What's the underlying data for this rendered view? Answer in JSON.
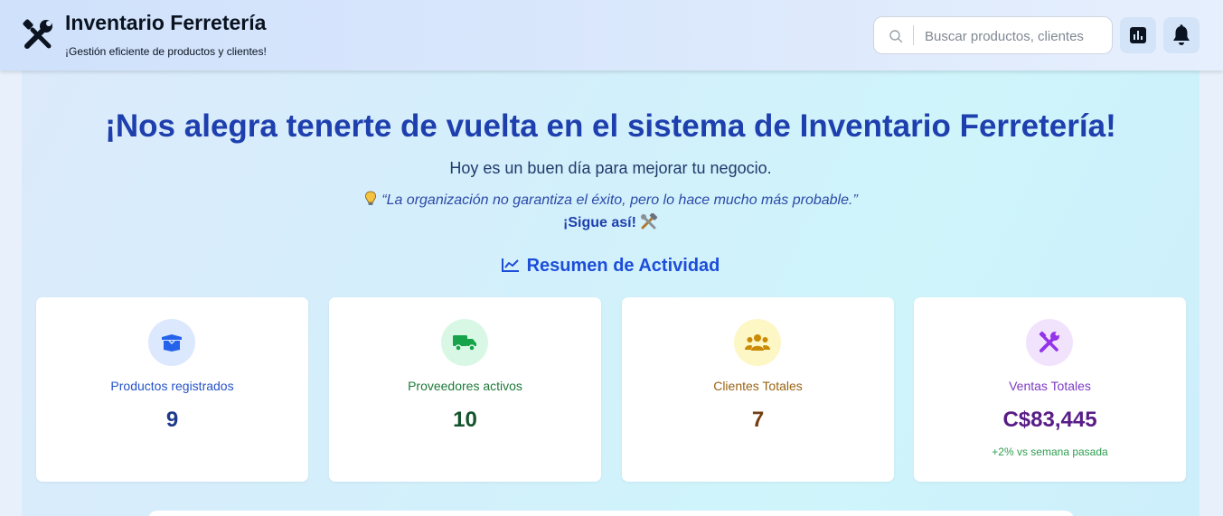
{
  "header": {
    "title": "Inventario Ferretería",
    "subtitle": "¡Gestión eficiente de productos y clientes!",
    "logo_icon": "tools-icon",
    "search": {
      "placeholder": "Buscar productos, clientes",
      "value": ""
    },
    "buttons": [
      {
        "icon": "bar-chart-icon"
      },
      {
        "icon": "bell-icon"
      }
    ]
  },
  "welcome": {
    "title": "¡Nos alegra tenerte de vuelta en el sistema de Inventario Ferretería!",
    "subtitle": "Hoy es un buen día para mejorar tu negocio.",
    "quote": "“La organización no garantiza el éxito, pero lo hace mucho más probable.”",
    "encouragement": "¡Sigue así!"
  },
  "summary": {
    "title": "Resumen de Actividad",
    "cards": [
      {
        "label": "Productos registrados",
        "value": "9",
        "icon": "box-icon",
        "accent": "#2553c9",
        "value_color": "#1e3a8a",
        "icon_bg": "#dbe8fd",
        "note": ""
      },
      {
        "label": "Proveedores activos",
        "value": "10",
        "icon": "truck-icon",
        "accent": "#1f7a3a",
        "value_color": "#14532d",
        "icon_bg": "#d9f7e5",
        "note": ""
      },
      {
        "label": "Clientes Totales",
        "value": "7",
        "icon": "users-icon",
        "accent": "#9a6412",
        "value_color": "#713f12",
        "icon_bg": "#fdf6c5",
        "note": ""
      },
      {
        "label": "Ventas Totales",
        "value": "C$83,445",
        "icon": "tools-icon",
        "accent": "#7e3bc6",
        "value_color": "#581c87",
        "icon_bg": "#f2e3fd",
        "note": "+2% vs semana pasada"
      }
    ]
  }
}
